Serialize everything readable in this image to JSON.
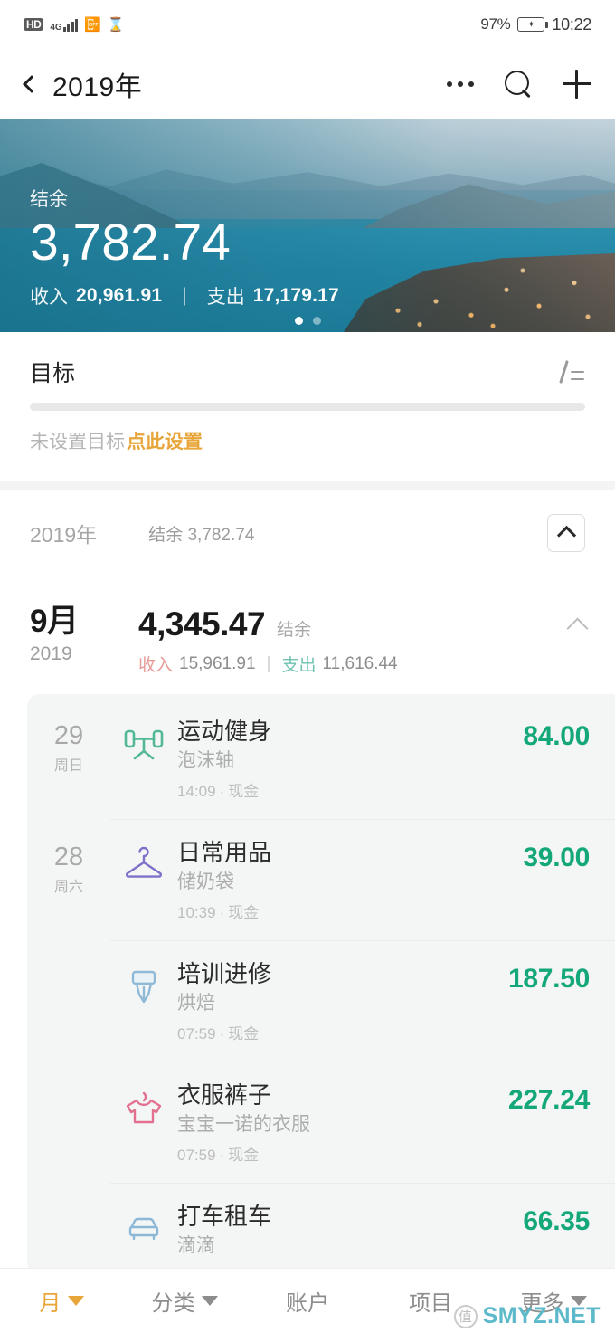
{
  "status_bar": {
    "hd_label": "HD",
    "network_label": "4G",
    "battery_percent": "97%",
    "time": "10:22"
  },
  "header": {
    "title": "2019年",
    "back_icon": "back-chevron-icon",
    "more_icon": "more-dots-icon",
    "search_icon": "search-icon",
    "add_icon": "plus-icon"
  },
  "hero": {
    "balance_label": "结余",
    "balance_value": "3,782.74",
    "income_label": "收入",
    "income_value": "20,961.91",
    "expense_label": "支出",
    "expense_value": "17,179.17",
    "separator": "|",
    "page_dots": 2,
    "active_dot": 1
  },
  "goal": {
    "title": "目标",
    "edit_icon": "edit-icon",
    "progress_percent": 0,
    "empty_text": "未设置目标",
    "link_text": "点此设置",
    "link_color": "#e8a53a"
  },
  "year_row": {
    "year_label": "2019年",
    "balance_label": "结余 3,782.74",
    "collapse_icon": "chevron-up-icon"
  },
  "month": {
    "month_label": "9月",
    "year_label": "2019",
    "balance_value": "4,345.47",
    "balance_caption": "结余",
    "income_label": "收入",
    "income_value": "15,961.91",
    "separator": "|",
    "expense_label": "支出",
    "expense_value": "11,616.44",
    "collapse_icon": "chevron-up-icon"
  },
  "transactions": [
    {
      "day": "29",
      "weekday": "周日",
      "icon": "dumbbell-icon",
      "icon_color": "#52b896",
      "category": "运动健身",
      "note": "泡沫轴",
      "time": "14:09",
      "account": "现金",
      "amount": "84.00"
    },
    {
      "day": "28",
      "weekday": "周六",
      "icon": "clothes-hanger-icon",
      "icon_color": "#7b72c9",
      "category": "日常用品",
      "note": "储奶袋",
      "time": "10:39",
      "account": "现金",
      "amount": "39.00"
    },
    {
      "day": "",
      "weekday": "",
      "icon": "pen-nib-icon",
      "icon_color": "#8fb9d4",
      "category": "培训进修",
      "note": "烘焙",
      "time": "07:59",
      "account": "现金",
      "amount": "187.50"
    },
    {
      "day": "",
      "weekday": "",
      "icon": "tshirt-icon",
      "icon_color": "#e2708f",
      "category": "衣服裤子",
      "note": "宝宝一诺的衣服",
      "time": "07:59",
      "account": "现金",
      "amount": "227.24"
    },
    {
      "day": "",
      "weekday": "",
      "icon": "car-icon",
      "icon_color": "#8cb8d8",
      "category": "打车租车",
      "note": "滴滴",
      "time": "",
      "account": "",
      "amount": "66.35"
    }
  ],
  "bottom_bar": {
    "items": [
      {
        "label": "月",
        "has_caret": true,
        "active": true
      },
      {
        "label": "分类",
        "has_caret": true,
        "active": false
      },
      {
        "label": "账户",
        "has_caret": false,
        "active": false
      },
      {
        "label": "项目",
        "has_caret": false,
        "active": false
      },
      {
        "label": "更多",
        "has_caret": true,
        "active": false
      }
    ]
  },
  "watermark": {
    "logo_char": "值",
    "text": "SMYZ.NET",
    "color": "#53b6c8"
  },
  "colors": {
    "amount_green": "#14a77a",
    "accent_orange": "#e8a53a",
    "hero_blue": "#1f7e9b"
  }
}
